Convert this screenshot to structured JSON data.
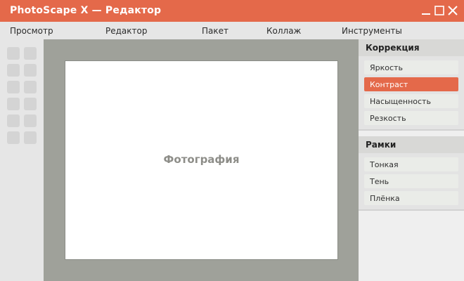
{
  "window": {
    "title": "PhotoScape X — Редактор",
    "controls": [
      "minimize-icon",
      "maximize-icon",
      "close-icon"
    ]
  },
  "menu": {
    "items": [
      "Просмотр",
      "Редактор",
      "Пакет",
      "Коллаж",
      "Инструменты"
    ]
  },
  "canvas": {
    "placeholder": "Фотография"
  },
  "panel": {
    "correction": {
      "title": "Коррекция",
      "items": [
        "Яркость",
        "Контраст",
        "Насыщенность",
        "Резкость"
      ],
      "selected": "Контраст"
    },
    "frames": {
      "title": "Рамки",
      "items": [
        "Тонкая",
        "Тень",
        "Плёнка"
      ]
    }
  },
  "colors": {
    "accent": "#e4694a",
    "canvas_bg": "#9fa19a",
    "tool_placeholder": "#d4d4d4"
  }
}
